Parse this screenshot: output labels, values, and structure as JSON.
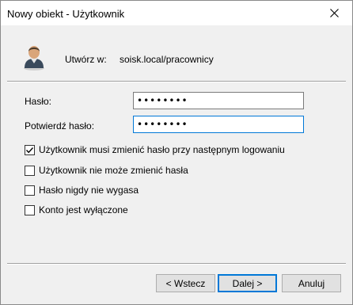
{
  "window": {
    "title": "Nowy obiekt - Użytkownik"
  },
  "header": {
    "create_in_label": "Utwórz w:",
    "create_in_path": "soisk.local/pracownicy"
  },
  "form": {
    "password_label": "Hasło:",
    "password_value": "••••••••",
    "confirm_label": "Potwierdź hasło:",
    "confirm_value": "••••••••"
  },
  "options": [
    {
      "label": "Użytkownik musi zmienić hasło przy następnym logowaniu",
      "checked": true
    },
    {
      "label": "Użytkownik nie może zmienić hasła",
      "checked": false
    },
    {
      "label": "Hasło nigdy nie wygasa",
      "checked": false
    },
    {
      "label": "Konto jest wyłączone",
      "checked": false
    }
  ],
  "buttons": {
    "back": "< Wstecz",
    "next": "Dalej >",
    "cancel": "Anuluj"
  },
  "icons": {
    "close": "close-icon",
    "user": "user-avatar-icon",
    "check": "checkmark-icon"
  },
  "colors": {
    "focus_border": "#0078d7",
    "dialog_bg": "#f0f0f0",
    "button_bg": "#e1e1e1"
  }
}
